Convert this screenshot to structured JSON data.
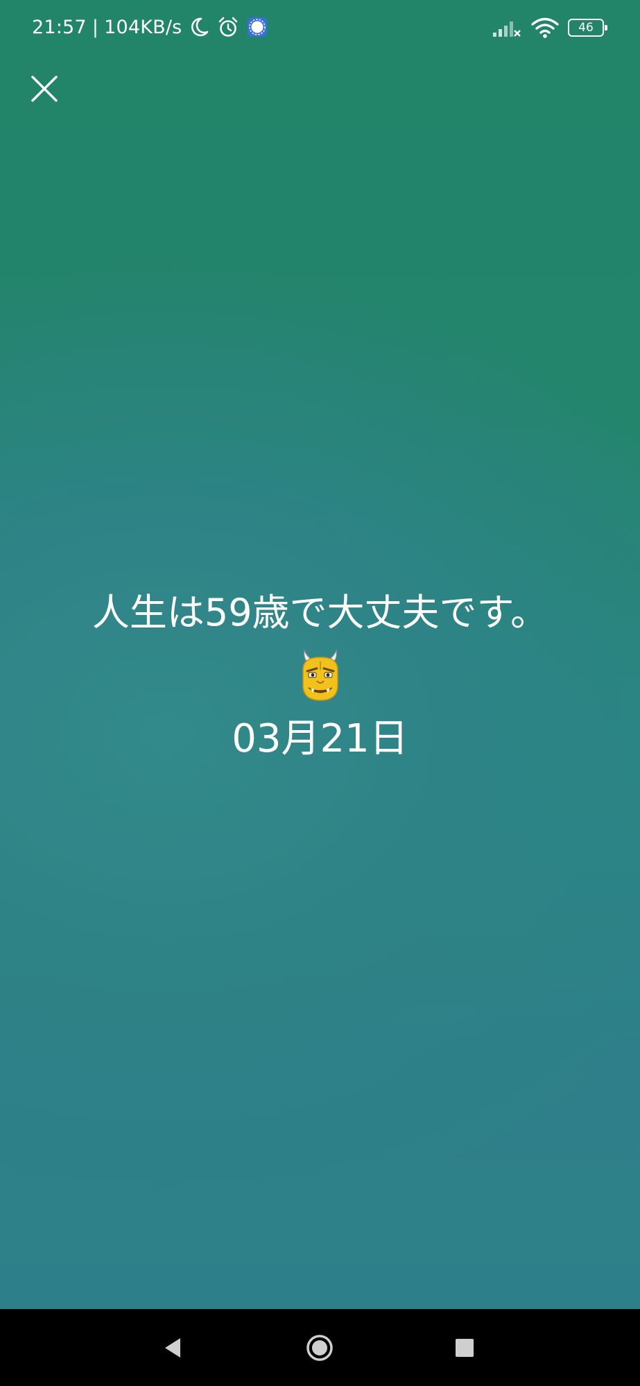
{
  "status_bar": {
    "time": "21:57",
    "separator": "|",
    "network_speed": "104KB/s",
    "icons_left": [
      "moon-icon",
      "alarm-icon",
      "signal-app-icon"
    ],
    "icons_right": [
      "cellular-signal-icon",
      "wifi-icon",
      "battery-icon"
    ],
    "battery_level": "46"
  },
  "close": {
    "icon": "close-icon"
  },
  "main": {
    "message": "人生は59歳で大丈夫です。",
    "emoji": "japanese-ogre-icon",
    "date": "03月21日"
  },
  "nav_bar": {
    "back_icon": "back-triangle-icon",
    "home_icon": "home-circle-icon",
    "recent_icon": "recent-square-icon"
  },
  "colors": {
    "background_top": "#228468",
    "background_bottom": "#2d8089",
    "text": "#ffffff",
    "nav_bar": "#000000"
  }
}
